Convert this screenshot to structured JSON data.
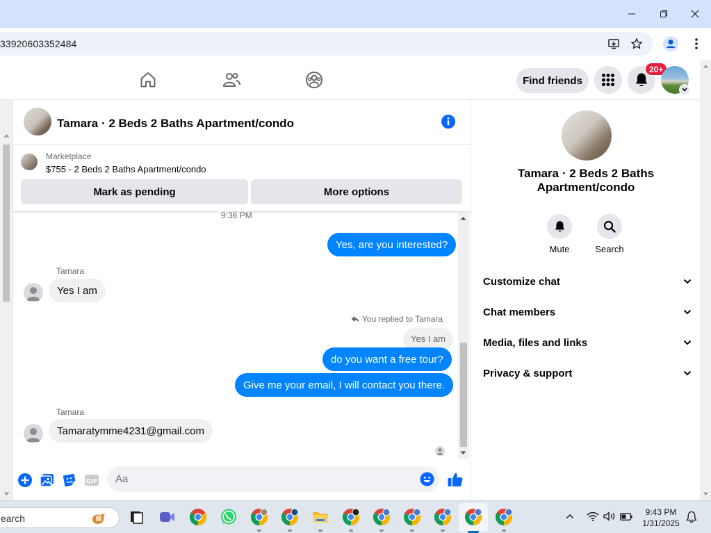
{
  "browser": {
    "url": "33920603352484",
    "colors": {
      "titlebar": "#d3e3fd",
      "omnibox": "#edf2fa"
    }
  },
  "nav": {
    "find_friends_label": "Find friends",
    "notification_count": "20+"
  },
  "chat": {
    "title": "Tamara · 2 Beds 2 Baths Apartment/condo",
    "marketplace_label": "Marketplace",
    "listing": "$755 - 2 Beds 2 Baths Apartment/condo",
    "mark_pending_label": "Mark as pending",
    "more_options_label": "More options",
    "timestamp": "9:36 PM",
    "sender": "Tamara",
    "messages": {
      "m1_out": "Yes, are you interested?",
      "m2_in": "Yes I am",
      "reply_note": "You replied to Tamara",
      "quoted_text": "Yes I am",
      "m3_out": "do you want a free tour?",
      "m4_out": "Give me your email, I will contact you there.",
      "m5_in": "Tamaratymme4231@gmail.com"
    },
    "composer_placeholder": "Aa",
    "accent_color": "#0084ff"
  },
  "details": {
    "title_line1": "Tamara · 2 Beds 2 Baths",
    "title_line2": "Apartment/condo",
    "mute_label": "Mute",
    "search_label": "Search",
    "sections": {
      "customize": "Customize chat",
      "members": "Chat members",
      "media": "Media, files and links",
      "privacy": "Privacy & support"
    }
  },
  "taskbar": {
    "search_text": "earch",
    "time": "9:43 PM",
    "date": "1/31/2025"
  }
}
